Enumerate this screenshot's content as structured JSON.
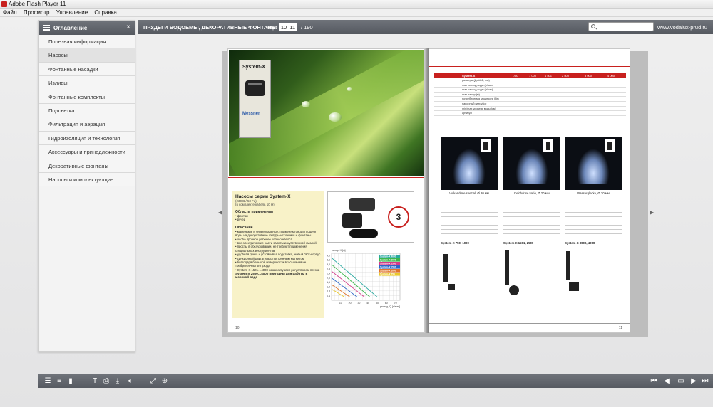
{
  "window": {
    "title": "Adobe Flash Player 11"
  },
  "menu": [
    "Файл",
    "Просмотр",
    "Управление",
    "Справка"
  ],
  "sidebar": {
    "title": "Оглавление",
    "items": [
      {
        "label": "Полезная информация"
      },
      {
        "label": "Насосы"
      },
      {
        "label": "Фонтанные насадки"
      },
      {
        "label": "Изливы"
      },
      {
        "label": "Фонтанные комплекты"
      },
      {
        "label": "Подсветка"
      },
      {
        "label": "Фильтрация и аэрация"
      },
      {
        "label": "Гидроизоляция и технология"
      },
      {
        "label": "Аксессуары и принадлежности"
      },
      {
        "label": "Декоративные фонтаны"
      },
      {
        "label": "Насосы и комплектующие"
      }
    ]
  },
  "topbar": {
    "section": "ПРУДЫ И ВОДОЕМЫ, ДЕКОРАТИВНЫЕ ФОНТАНЫ",
    "page_label": "стр:",
    "page_value": "10–11",
    "page_total": "/ 190",
    "site": "www.vodalux-prud.ru"
  },
  "left_page": {
    "product_card": "System-X",
    "brand": "Messner",
    "title": "Насосы серии System-X",
    "subtitle": "(230 В / 50 Гц)",
    "subtitle2": "(в комплекте кабель 10 м)",
    "area_title": "Область применения",
    "areas": [
      "• фонтан",
      "• ручей"
    ],
    "desc_title": "Описание",
    "desc": [
      "• маленькие и универсальные, применяются для подачи воды на декоративные фигуры-источники и фонтаны",
      "• особо прочное рабочее колесо насоса",
      "• все электрические части залиты искусственной смолой",
      "• просты в обслуживании, не требуют применения специальных инструментов",
      "• удобная ручка и устойчивая подставка, новый click-корпус",
      "• синхронный двигатель с постоянным магнитом",
      "• благодаря большой поверхности всасывания не требуется частого ухода",
      "• System-X 1501…4000 комплектуются регулятором потока"
    ],
    "warning": "System-X 2500…4000 пригодны для работы в морской воде",
    "badge": "3",
    "page_number": "10"
  },
  "chart_data": {
    "type": "line",
    "title": "",
    "ylabel": "напор, H [м]",
    "xlabel": "расход, Q [л/мин]",
    "y_ticks": [
      "4,0",
      "3,6",
      "3,2",
      "2,8",
      "2,4",
      "2,0",
      "1,6",
      "1,2",
      "0,8",
      "0,4"
    ],
    "x_ticks": [
      "10",
      "20",
      "30",
      "40",
      "50",
      "60",
      "70"
    ],
    "ylim": [
      0,
      4.2
    ],
    "xlim": [
      0,
      75
    ],
    "series": [
      {
        "name": "System-X 4000",
        "color": "#2aa9a0",
        "values": [
          [
            0,
            3.8
          ],
          [
            50,
            0.3
          ]
        ]
      },
      {
        "name": "System-X 3000",
        "color": "#3cb64a",
        "values": [
          [
            0,
            3.2
          ],
          [
            42,
            0.3
          ]
        ]
      },
      {
        "name": "System-X 2500",
        "color": "#d43b8a",
        "values": [
          [
            0,
            2.6
          ],
          [
            36,
            0.3
          ]
        ]
      },
      {
        "name": "System-X 1501",
        "color": "#2b66c8",
        "values": [
          [
            0,
            2.0
          ],
          [
            28,
            0.3
          ]
        ]
      },
      {
        "name": "System-X 1000",
        "color": "#e0742a",
        "values": [
          [
            0,
            1.4
          ],
          [
            20,
            0.3
          ]
        ]
      },
      {
        "name": "System-X 750",
        "color": "#e9c82a",
        "values": [
          [
            0,
            1.0
          ],
          [
            14,
            0.3
          ]
        ]
      }
    ]
  },
  "right_page": {
    "table_header": [
      "System-X",
      "750",
      "1 000",
      "1 501",
      "2 500",
      "3 000",
      "4 000"
    ],
    "table_rows": [
      "размеры (ДхШхВ, мм)",
      "max расход воды (л/мин)",
      "max расход воды (л/час)",
      "max напор (м)",
      "потребляемая мощность (Вт)",
      "напорный патрубок",
      "min/max уровень воды (см)",
      "артикул"
    ],
    "fountains": [
      {
        "caption": "Vulkandüse spezial, Ø 20 мм"
      },
      {
        "caption": "Kelchdüse vario, Ø 20 мм"
      },
      {
        "caption": "Wasserglocke, Ø 30 мм"
      }
    ],
    "parts": [
      "System-X 750, 1000",
      "System-X 1501, 2500",
      "System-X 3000, 4000"
    ],
    "page_number": "11"
  },
  "colors": {
    "accent": "#c8201e",
    "bar": "#5e6268"
  },
  "toolbar_icons": [
    "list-icon",
    "bookmark-icon",
    "text-icon",
    "print-icon",
    "download-icon",
    "sound-icon",
    "fullscreen-icon",
    "zoom-icon",
    "first-page-icon",
    "prev-page-icon",
    "two-page-icon",
    "next-page-icon",
    "last-page-icon"
  ]
}
